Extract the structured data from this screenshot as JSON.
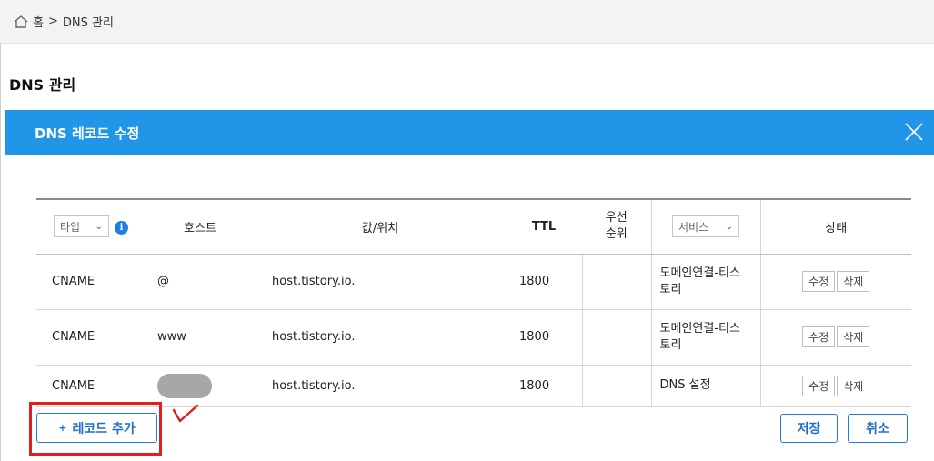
{
  "breadcrumb": {
    "home": "홈",
    "separator": ">",
    "current": "DNS 관리"
  },
  "page": {
    "title": "DNS 관리"
  },
  "modal": {
    "title": "DNS 레코드 수정",
    "header_color": "#2196e8"
  },
  "table": {
    "headers": {
      "type_select": "타입",
      "info": "i",
      "host": "호스트",
      "value": "값/위치",
      "ttl": "TTL",
      "priority_line1": "우선",
      "priority_line2": "순위",
      "service_select": "서비스",
      "status": "상태"
    },
    "rows": [
      {
        "type": "CNAME",
        "host": "@",
        "value": "host.tistory.io.",
        "ttl": "1800",
        "priority": "",
        "service": "도메인연결-티스토리",
        "edit": "수정",
        "delete": "삭제"
      },
      {
        "type": "CNAME",
        "host": "www",
        "value": "host.tistory.io.",
        "ttl": "1800",
        "priority": "",
        "service": "도메인연결-티스토리",
        "edit": "수정",
        "delete": "삭제"
      },
      {
        "type": "CNAME",
        "host": "",
        "value": "host.tistory.io.",
        "ttl": "1800",
        "priority": "",
        "service": "DNS 설정",
        "edit": "수정",
        "delete": "삭제"
      }
    ]
  },
  "actions": {
    "add_plus": "+",
    "add_record": "레코드 추가",
    "save": "저장",
    "cancel": "취소"
  },
  "annotation_color": "#e41d1d"
}
